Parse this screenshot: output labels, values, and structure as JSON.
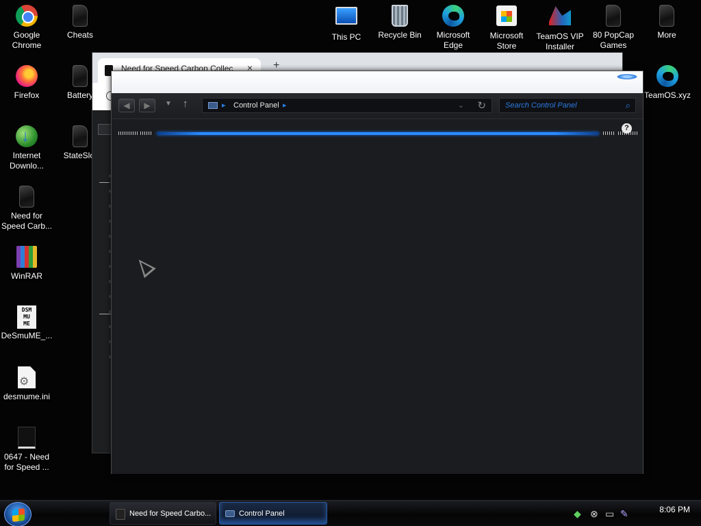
{
  "desktop": {
    "icons_left": [
      {
        "label": "Google Chrome",
        "icon": "chrome-icon"
      },
      {
        "label": "Firefox",
        "icon": "firefox-icon"
      },
      {
        "label": "Internet Downlo...",
        "icon": "idm-icon"
      },
      {
        "label": "Need for Speed Carb...",
        "icon": "nfs-icon"
      },
      {
        "label": "WinRAR",
        "icon": "winrar-icon"
      },
      {
        "label": "DeSmuME_...",
        "icon": "desmume-icon"
      },
      {
        "label": "desmume.ini",
        "icon": "ini-file-icon"
      },
      {
        "label": "0647 - Need for Speed ...",
        "icon": "file-icon"
      }
    ],
    "icons_col2": [
      {
        "label": "Cheats",
        "icon": "nfs-icon"
      },
      {
        "label": "Battery",
        "icon": "nfs-icon"
      },
      {
        "label": "StateSlot",
        "icon": "nfs-icon"
      }
    ],
    "icons_top": [
      {
        "label": "This PC",
        "icon": "computer-icon"
      },
      {
        "label": "Recycle Bin",
        "icon": "recycle-bin-icon"
      },
      {
        "label": "Microsoft Edge",
        "icon": "edge-icon"
      },
      {
        "label": "Microsoft Store",
        "icon": "store-icon"
      },
      {
        "label": "TeamOS VIP Installer",
        "icon": "teamos-icon"
      },
      {
        "label": "80 PopCap Games",
        "icon": "nfs-icon"
      },
      {
        "label": "More",
        "icon": "nfs-icon"
      }
    ],
    "icon_right": {
      "label": "TeamOS.xyz",
      "icon": "edge-icon"
    }
  },
  "browser_window": {
    "tab_title": "Need for Speed Carbon Collec",
    "close_glyph": "×",
    "new_tab_glyph": "+"
  },
  "control_panel": {
    "address": {
      "location": "Control Panel"
    },
    "search": {
      "placeholder": "Search Control Panel"
    },
    "help_glyph": "?"
  },
  "taskbar": {
    "buttons": [
      {
        "label": "Need for Speed Carbo...",
        "icon": "nfs-icon",
        "active": false
      },
      {
        "label": "Control Panel",
        "icon": "control-panel-icon",
        "active": true
      }
    ],
    "clock": "8:06 PM"
  },
  "colors": {
    "accent": "#2a7be0",
    "background": "#050505"
  }
}
